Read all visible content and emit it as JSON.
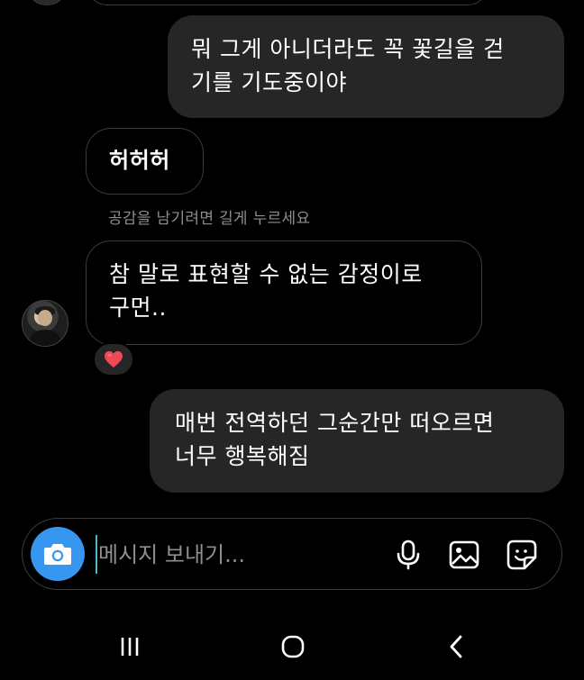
{
  "messages": [
    {
      "id": "msg1",
      "direction": "sent",
      "text": "뭐 그게 아니더라도 꼭 꽃길을 걷\n기를 기도중이야"
    },
    {
      "id": "msg2",
      "direction": "received",
      "text": "허허허"
    },
    {
      "id": "msg3",
      "direction": "received",
      "text": "참 말로 표현할 수 없는 감정이로\n구먼..",
      "reaction": "heart"
    },
    {
      "id": "msg4",
      "direction": "sent",
      "text": "매번 전역하던 그순간만 떠오르면\n너무 행복해짐"
    }
  ],
  "hint_text": "공감을 남기려면 길게 누르세요",
  "composer": {
    "placeholder": "메시지 보내기...",
    "value": "",
    "camera_icon": "camera-icon",
    "mic_icon": "microphone-icon",
    "gallery_icon": "image-icon",
    "sticker_icon": "sticker-icon"
  },
  "navbar": {
    "recents_icon": "recent-apps-icon",
    "home_icon": "home-icon",
    "back_icon": "back-icon"
  },
  "colors": {
    "background": "#000000",
    "sent_bubble": "#262626",
    "received_border": "#3b3b3b",
    "camera_button": "#3797f0",
    "reaction_heart": "#ed4956",
    "muted_text": "#8e8e8e"
  }
}
